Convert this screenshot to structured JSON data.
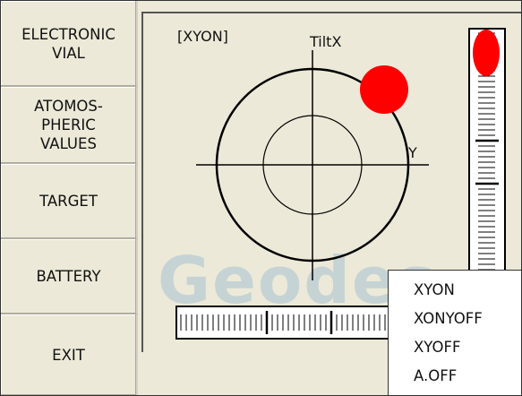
{
  "sidebar": {
    "items": [
      {
        "label": "ELECTRONIC\nVIAL"
      },
      {
        "label": "ATOMOS-\nPHERIC\nVALUES"
      },
      {
        "label": "TARGET"
      },
      {
        "label": "BATTERY"
      },
      {
        "label": "EXIT"
      }
    ]
  },
  "display": {
    "mode_label": "[XYON]",
    "tilt_axis_label": "TiltX",
    "y_axis_label": "Y"
  },
  "menu": {
    "items": [
      {
        "label": "XYON"
      },
      {
        "label": "XONYOFF"
      },
      {
        "label": "XYOFF"
      },
      {
        "label": "A.OFF"
      }
    ]
  },
  "watermark": "Geodes",
  "colors": {
    "bubble": "#ff0000",
    "panel_bg": "#ece9d8",
    "menu_bg": "#ffffff"
  }
}
